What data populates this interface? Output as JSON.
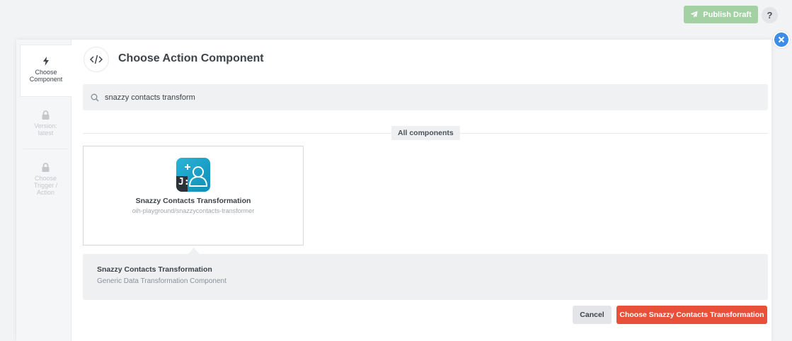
{
  "topbar": {
    "publish_label": "Publish Draft",
    "publish_icon": "paper-plane-icon",
    "help_label": "?"
  },
  "modal": {
    "title": "Choose Action Component",
    "header_icon": "code-icon",
    "close_icon": "close-icon"
  },
  "stepper": {
    "steps": [
      {
        "label_line1": "Choose",
        "label_line2": "Component",
        "icon": "lightning-icon",
        "state": "active"
      },
      {
        "label_line1": "Version:",
        "label_line2": "latest",
        "icon": "lock-icon",
        "state": "locked"
      },
      {
        "label_line1": "Choose",
        "label_line2": "Trigger /",
        "label_line3": "Action",
        "icon": "lock-icon",
        "state": "locked"
      }
    ]
  },
  "search": {
    "value": "snazzy contacts transform",
    "icon": "search-icon"
  },
  "divider_label": "All components",
  "components": [
    {
      "name": "Snazzy Contacts Transformation",
      "path": "oih-playground/snazzycontacts-transformer",
      "logo_text": "J:",
      "logo_colors": [
        "#2bb3d6",
        "#0d8fb9"
      ]
    }
  ],
  "selected": {
    "name": "Snazzy Contacts Transformation",
    "description": "Generic Data Transformation Component"
  },
  "footer": {
    "cancel_label": "Cancel",
    "choose_label": "Choose Snazzy Contacts Transformation"
  },
  "colors": {
    "accent_red": "#e8503a",
    "publish_green": "#a3d1a3",
    "close_blue": "#3d8ce8"
  }
}
